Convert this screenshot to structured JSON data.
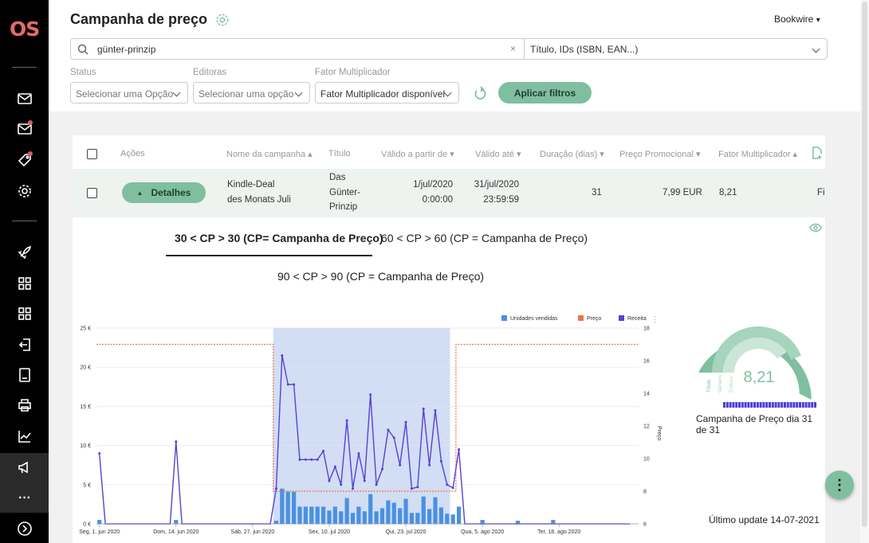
{
  "app": {
    "logo": "OS"
  },
  "sidebar": {
    "icons": [
      "mail-icon",
      "mail-notification-icon",
      "tag-icon",
      "gear-icon",
      "rocket-icon",
      "grid-icon",
      "grid-icon",
      "export-icon",
      "book-icon",
      "print-icon",
      "chart-icon",
      "megaphone-icon",
      "more-icon",
      "arrow-right-icon"
    ]
  },
  "header": {
    "title": "Campanha de preço",
    "user": "Bookwire",
    "user_menu_icon": "▾"
  },
  "search": {
    "value": "günter-prinzip",
    "clear": "×",
    "type": "Título, IDs (ISBN, EAN...)"
  },
  "filters": {
    "status": {
      "label": "Status",
      "value": "Selecionar uma Opção"
    },
    "publishers": {
      "label": "Editoras",
      "value": "Selecionar uma opção"
    },
    "multiplier": {
      "label": "Fator Multiplicador",
      "value": "Fator Multiplicador disponível"
    },
    "apply": "Aplicar filtros"
  },
  "table": {
    "headers": {
      "actions": "Ações",
      "campaign": "Nome da campanha",
      "title": "Título",
      "valid_from": "Válido a partir de",
      "valid_to": "Válido até",
      "duration": "Duração (dias)",
      "price": "Preço Promocional",
      "factor": "Fator Multiplicador"
    },
    "row": {
      "details": "Detalhes",
      "campaign": [
        "Kindle-Deal",
        "des Monats Juli"
      ],
      "title": [
        "Das",
        "Günter-",
        "Prinzip"
      ],
      "valid_from": [
        "1/jul/2020",
        "0:00:00"
      ],
      "valid_to": [
        "31/jul/2020",
        "23:59:59"
      ],
      "duration": "31",
      "price": "7,99 EUR",
      "factor": "8,21",
      "extra": "Fi"
    }
  },
  "tabs": [
    "30 < CP > 30 (CP= Campanha de Preço)",
    "60 < CP > 60 (CP = Campanha de Preço)",
    "90 < CP > 90 (CP = Campanha de Preço)"
  ],
  "chart_data": {
    "type": "bar+line",
    "legend": [
      "Unidades vendidas",
      "Preço",
      "Receita"
    ],
    "legend_colors": [
      "#4a90e2",
      "#e8744f",
      "#5a3fd6"
    ],
    "y_left": {
      "ticks": [
        "25 €",
        "20 €",
        "15 €",
        "10 €",
        "5 €",
        "0 €"
      ],
      "range": [
        0,
        25
      ]
    },
    "y_right": {
      "label": "Preço",
      "ticks": [
        "18",
        "16",
        "14",
        "12",
        "10",
        "8",
        "6"
      ],
      "range": [
        6,
        18
      ]
    },
    "x_ticks": [
      "Seg, 1. jun 2020",
      "Dom, 14. jun 2020",
      "Sáb, 27. jun 2020",
      "Sex, 10. jul 2020",
      "Qui, 23. jul 2020",
      "Qua, 5. ago 2020",
      "Ter, 18. ago 2020"
    ],
    "days": [
      "2020-06-01",
      "2020-08-31"
    ],
    "campaign_days": [
      30,
      60
    ],
    "revenue": [
      9,
      0,
      0,
      0,
      0,
      0,
      0,
      0,
      0,
      0,
      0,
      0,
      0,
      10.5,
      0,
      0,
      0,
      0,
      0,
      0,
      0,
      0,
      0,
      0,
      0,
      0,
      0,
      0,
      0,
      0,
      0,
      0,
      0,
      0,
      0,
      9.2,
      0,
      9.2,
      0,
      0,
      0,
      0,
      0,
      0,
      0,
      0,
      0,
      0,
      0,
      0,
      0,
      0,
      0,
      0,
      0,
      0,
      0,
      0,
      0,
      0,
      0,
      0,
      0,
      0,
      0,
      0,
      0,
      0,
      0,
      0,
      0,
      0,
      0,
      0,
      0,
      0,
      0,
      0,
      0,
      0,
      0,
      0,
      0,
      0,
      0,
      0,
      0,
      0,
      0,
      0,
      0
    ],
    "revenue_campaign": [
      4.5,
      21.5,
      17.8,
      17.8,
      8.2,
      8.2,
      8.2,
      8.2,
      9.3,
      5.5,
      7.3,
      5,
      13.2,
      4.5,
      9,
      5.5,
      16.5,
      5,
      7,
      12,
      11,
      7.5,
      13,
      4.5,
      4.7,
      14.7,
      7.5,
      14.5,
      8,
      5,
      4.6,
      9.5
    ],
    "price": [
      17,
      17,
      17,
      17,
      17,
      17,
      17,
      17,
      17,
      17,
      17,
      17,
      17,
      17,
      17,
      17,
      17,
      17,
      17,
      17,
      17,
      17,
      17,
      17,
      17,
      17,
      17,
      17,
      17,
      17,
      8,
      8,
      8,
      8,
      8,
      8,
      8,
      8,
      8,
      8,
      8,
      8,
      8,
      8,
      8,
      8,
      8,
      8,
      8,
      8,
      8,
      8,
      8,
      8,
      8,
      8,
      8,
      8,
      8,
      8,
      8,
      17,
      17,
      17,
      17,
      17,
      17,
      17,
      17,
      17,
      17,
      17,
      17,
      17,
      17,
      17,
      17,
      17,
      17,
      17,
      17,
      17,
      17,
      17,
      17,
      17,
      17,
      17,
      17,
      17,
      17,
      17
    ],
    "units": [
      0.5,
      0,
      0,
      0,
      0,
      0,
      0,
      0,
      0,
      0,
      0,
      0,
      0,
      0.5,
      0,
      0,
      0,
      0,
      0,
      0,
      0,
      0,
      0,
      0,
      0,
      0,
      0,
      0,
      0,
      0,
      0.4,
      4.5,
      4.1,
      4.1,
      2.2,
      2.2,
      2.2,
      2.2,
      2.2,
      1.7,
      2.2,
      1.6,
      3.3,
      1.4,
      2.2,
      1.6,
      3.8,
      1.6,
      2,
      3,
      2.7,
      2,
      3.2,
      1.4,
      1.4,
      3.5,
      1.9,
      3.4,
      2.1,
      1.3,
      1.2,
      2.2,
      0,
      0,
      0,
      0.5,
      0,
      0,
      0,
      0,
      0,
      0.4,
      0,
      0,
      0,
      0,
      0,
      0.5,
      0,
      0,
      0,
      0,
      0,
      0,
      0,
      0,
      0,
      0,
      0,
      0,
      0,
      0
    ]
  },
  "gauge": {
    "value": "8,21",
    "labels": [
      "Título",
      "Género",
      "Editora"
    ],
    "caption": "Campanha de Preço dia 31 de 31",
    "segments": 31
  },
  "last_update": "Último update 14-07-2021",
  "fab": "⋮"
}
